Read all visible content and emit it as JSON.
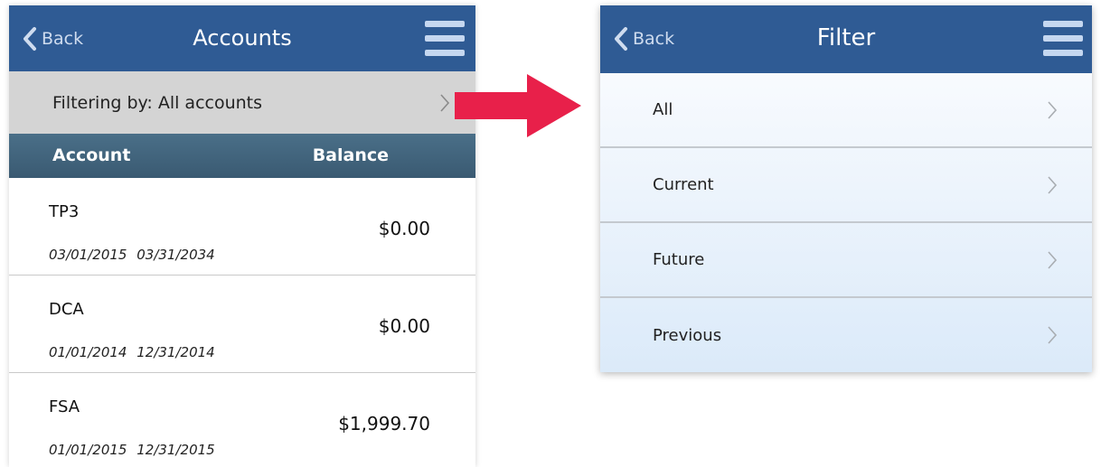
{
  "left": {
    "nav": {
      "back_label": "Back",
      "title": "Accounts"
    },
    "filter_bar": {
      "label": "Filtering by: All accounts"
    },
    "columns": {
      "account": "Account",
      "balance": "Balance"
    },
    "accounts": [
      {
        "name": "TP3",
        "start_date": "03/01/2015",
        "end_date": "03/31/2034",
        "balance": "$0.00"
      },
      {
        "name": "DCA",
        "start_date": "01/01/2014",
        "end_date": "12/31/2014",
        "balance": "$0.00"
      },
      {
        "name": "FSA",
        "start_date": "01/01/2015",
        "end_date": "12/31/2015",
        "balance": "$1,999.70"
      }
    ]
  },
  "right": {
    "nav": {
      "back_label": "Back",
      "title": "Filter"
    },
    "items": [
      {
        "label": "All"
      },
      {
        "label": "Current"
      },
      {
        "label": "Future"
      },
      {
        "label": "Previous"
      }
    ]
  },
  "icons": {
    "back": "chevron-left-icon",
    "menu": "hamburger-menu-icon",
    "row": "chevron-right-icon",
    "transition": "right-arrow-icon"
  },
  "colors": {
    "navbar": "#2f5b94",
    "filter_bar": "#d4d4d4",
    "column_header": "#3f6078",
    "arrow": "#e8204a"
  }
}
